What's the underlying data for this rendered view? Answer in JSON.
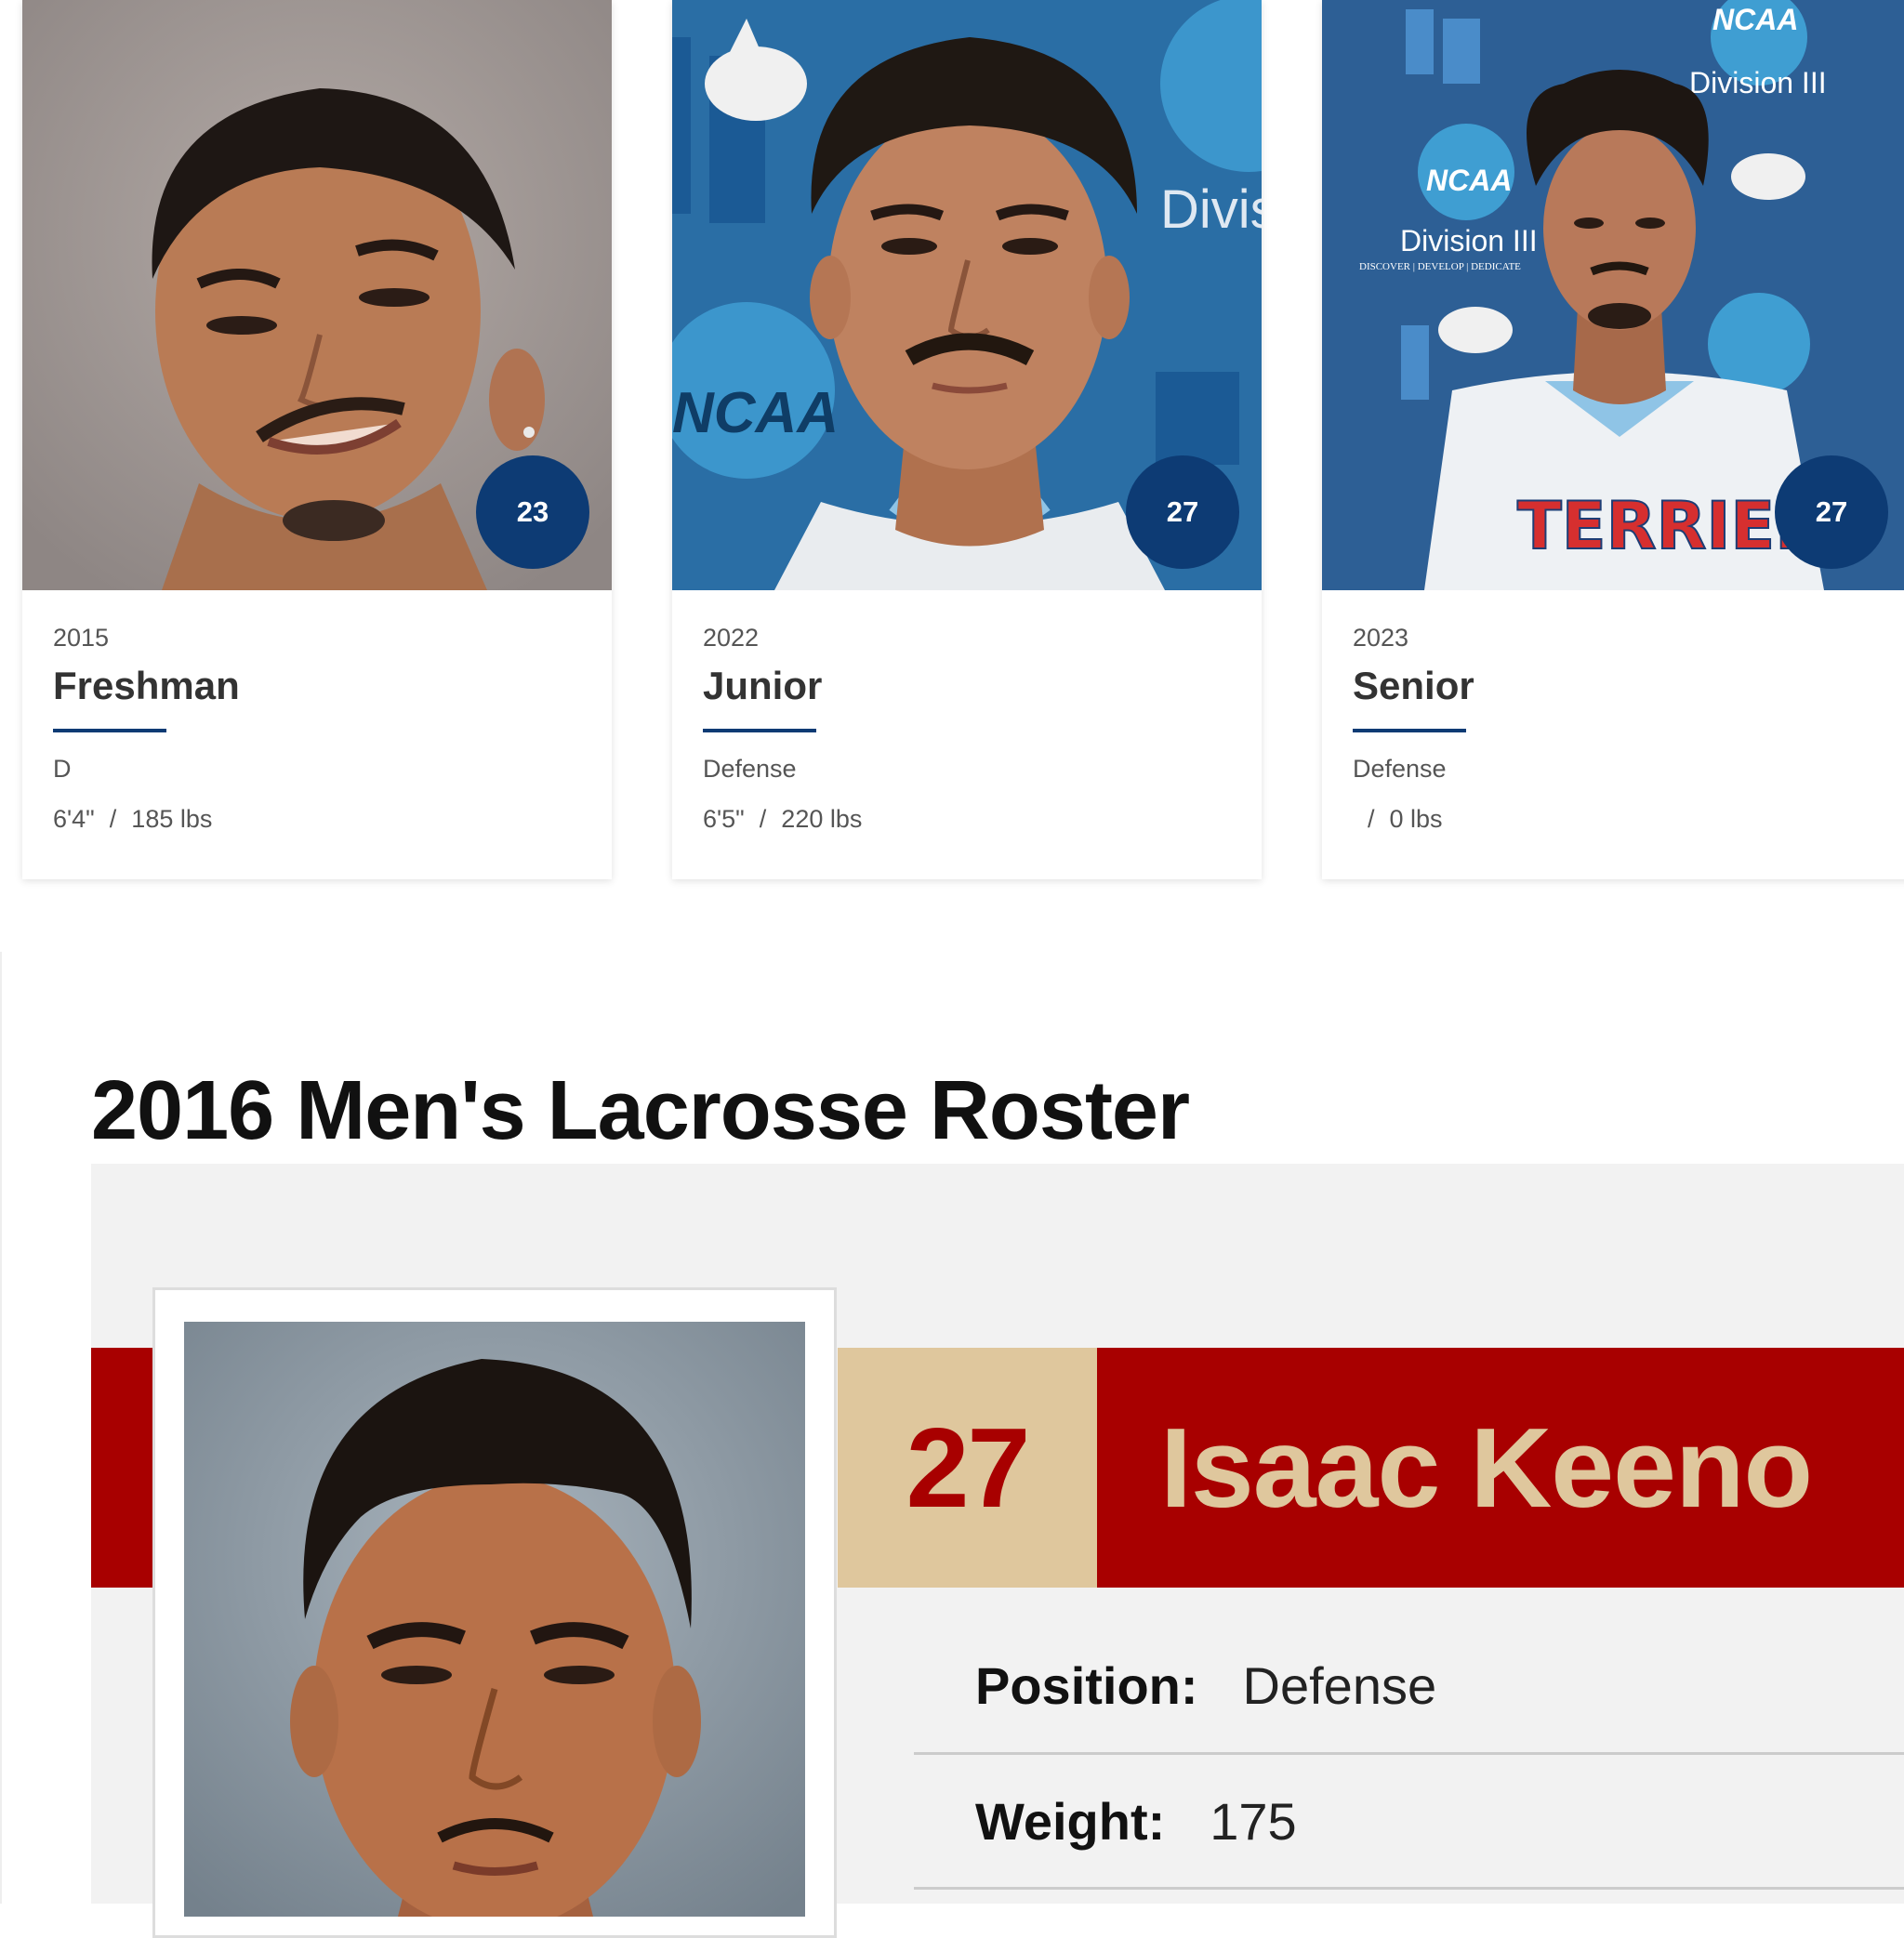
{
  "history_cards": [
    {
      "year": "2015",
      "class": "Freshman",
      "number": "23",
      "position": "D",
      "height": "6'4\"",
      "weight": "185 lbs",
      "photo_backdrop": "gray studio"
    },
    {
      "year": "2022",
      "class": "Junior",
      "number": "27",
      "position": "Defense",
      "height": "6'5\"",
      "weight": "220 lbs",
      "photo_backdrop": "blue NCAA Division III backdrop"
    },
    {
      "year": "2023",
      "class": "Senior",
      "number": "27",
      "position": "Defense",
      "height": "",
      "weight": "0 lbs",
      "photo_backdrop": "blue NCAA Division III backdrop"
    }
  ],
  "size_separator": "/",
  "photo_text": {
    "ncaa": "NCAA",
    "division": "Division III",
    "tagline": "DISCOVER | DEVELOP | DEDICATE",
    "jersey_text": "TERRIERS"
  },
  "roster": {
    "title": "2016 Men's Lacrosse Roster"
  },
  "player": {
    "number": "27",
    "name": "Isaac Keeno",
    "fields": [
      {
        "label": "Position:",
        "value": "Defense"
      },
      {
        "label": "Weight:",
        "value": "175"
      }
    ]
  },
  "colors": {
    "navy_badge": "#0d3b74",
    "roster_red": "#a80000",
    "roster_tan": "#dfc79d",
    "panel_gray": "#f2f2f2"
  }
}
